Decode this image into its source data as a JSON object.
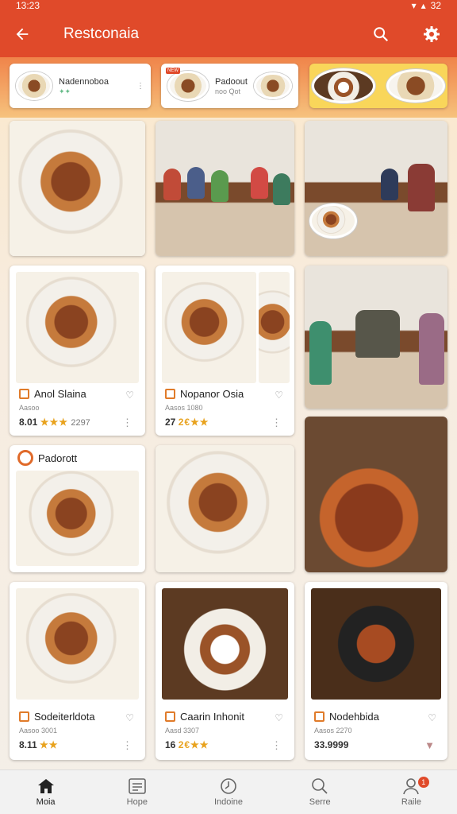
{
  "status": {
    "time": "13:23",
    "battery": "32"
  },
  "appbar": {
    "title": "Restconaia"
  },
  "chips": [
    {
      "title": "Nadennoboa",
      "sub": "✦✦",
      "more": "⋮"
    },
    {
      "badge": "NEW",
      "title": "Padoout",
      "sub": "noo Qot"
    },
    {
      "title": ""
    }
  ],
  "cards": [
    {
      "name": "Anol Slaina",
      "meta": "Aasoo",
      "rating": "8.01",
      "stars": "★★★",
      "count": "2297"
    },
    {
      "name": "Nopanor Osia",
      "meta": "Aasos 1080",
      "rating": "27",
      "stars": "2€★★"
    },
    {
      "name": "Padorott"
    },
    {
      "name": "Sodeiterldota",
      "meta": "Aasoo 3001",
      "rating": "8.11",
      "stars": "★★"
    },
    {
      "name": "Caarin Inhonit",
      "meta": "Aasd 3307",
      "rating": "16",
      "stars": "2€★★"
    },
    {
      "name": "Nodehbida",
      "meta": "Aasos 2270",
      "rating": "33.9999"
    }
  ],
  "tabs": [
    {
      "label": "Moia",
      "icon": "home-icon"
    },
    {
      "label": "Hope",
      "icon": "list-icon"
    },
    {
      "label": "Indoine",
      "icon": "clock-icon"
    },
    {
      "label": "Serre",
      "icon": "search-icon"
    },
    {
      "label": "Raile",
      "icon": "profile-icon",
      "badge": "1"
    }
  ]
}
